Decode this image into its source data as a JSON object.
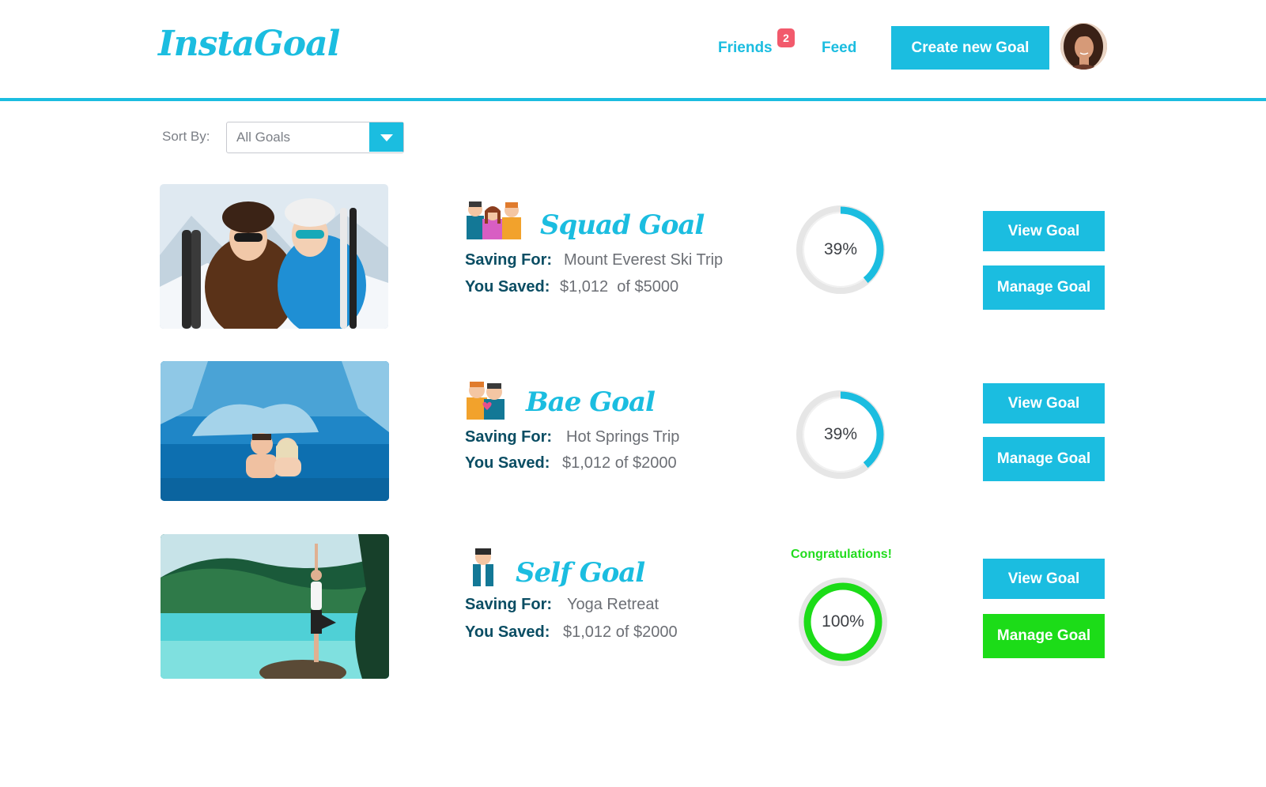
{
  "header": {
    "logo": "InstaGoal",
    "nav": {
      "friends": "Friends",
      "friends_badge": "2",
      "feed": "Feed"
    },
    "create_button": "Create new Goal"
  },
  "sort": {
    "label": "Sort By:",
    "value": "All Goals"
  },
  "goals": [
    {
      "title": "Squad Goal",
      "saving_label": "Saving For:",
      "saving_for": "Mount Everest Ski Trip",
      "saved_label": "You Saved:",
      "saved": "$1,012  of $5000",
      "progress": 39,
      "progress_text": "39%",
      "view_button": "View Goal",
      "manage_button": "Manage Goal"
    },
    {
      "title": "Bae Goal",
      "saving_label": "Saving For:",
      "saving_for": "Hot Springs Trip",
      "saved_label": "You Saved:",
      "saved": "$1,012 of $2000",
      "progress": 39,
      "progress_text": "39%",
      "view_button": "View Goal",
      "manage_button": "Manage Goal"
    },
    {
      "title": "Self Goal",
      "saving_label": "Saving For:",
      "saving_for": "Yoga Retreat",
      "saved_label": "You Saved:",
      "saved": "$1,012 of $2000",
      "progress": 100,
      "progress_text": "100%",
      "status": "Congratulations!",
      "view_button": "View Goal",
      "manage_button": "Manage Goal"
    }
  ],
  "colors": {
    "accent": "#1bbde0",
    "dark_text": "#0a4d63",
    "success": "#1cdc18",
    "badge": "#f25a6c",
    "ring_track": "#e6e6e6"
  }
}
